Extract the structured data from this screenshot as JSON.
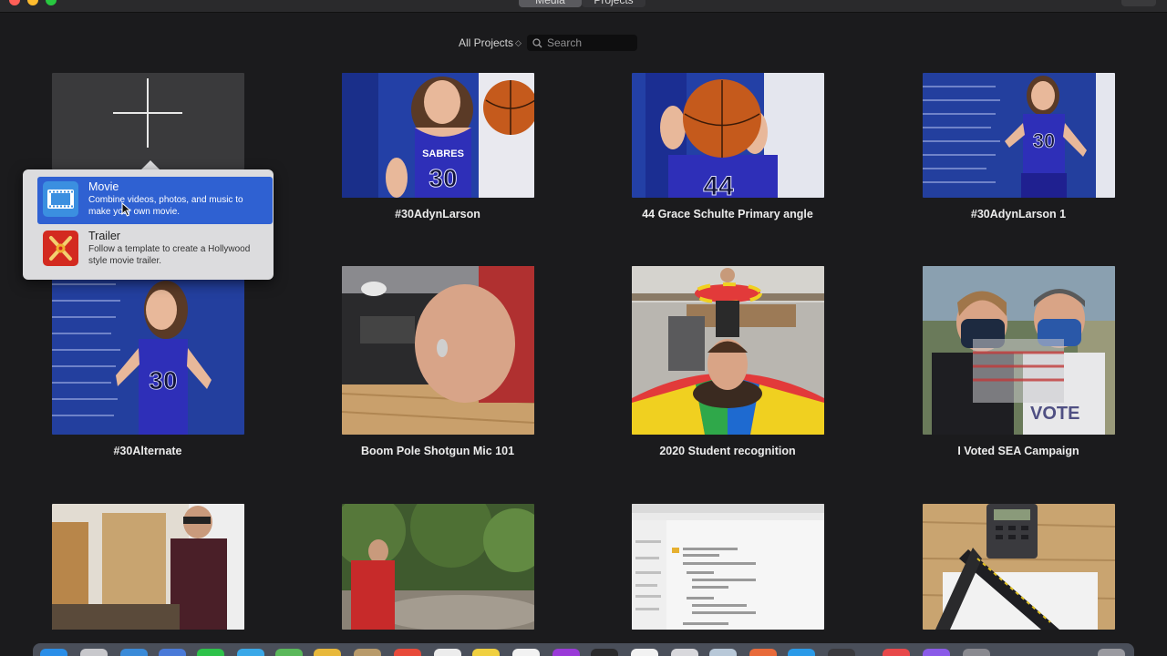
{
  "toolbar": {
    "tabs": [
      {
        "label": "Media",
        "selected": true
      },
      {
        "label": "Projects",
        "selected": false
      }
    ]
  },
  "filter": {
    "label": "All Projects",
    "search_placeholder": "Search"
  },
  "popover": {
    "items": [
      {
        "title": "Movie",
        "description": "Combine videos, photos, and music to make your own movie.",
        "icon": "film-strip-icon",
        "highlighted": true
      },
      {
        "title": "Trailer",
        "description": "Follow a template to create a Hollywood style movie trailer.",
        "icon": "clapper-icon",
        "highlighted": false
      }
    ]
  },
  "projects": [
    {
      "title": "#30AdynLarson"
    },
    {
      "title": "44 Grace Schulte Primary angle"
    },
    {
      "title": "#30AdynLarson 1"
    },
    {
      "title": "#30Alternate"
    },
    {
      "title": "Boom Pole Shotgun Mic 101"
    },
    {
      "title": "2020 Student recognition"
    },
    {
      "title": "I Voted SEA Campaign"
    }
  ],
  "thumbnail_text": {
    "jersey_team": "SABRES",
    "jersey_30": "30",
    "jersey_44": "44",
    "ballot_word": "VOTE"
  },
  "colors": {
    "background": "#1b1b1d",
    "popover_highlight": "#2f61d2",
    "jersey_blue": "#2e2fb8",
    "wall_blue": "#2340a6"
  }
}
